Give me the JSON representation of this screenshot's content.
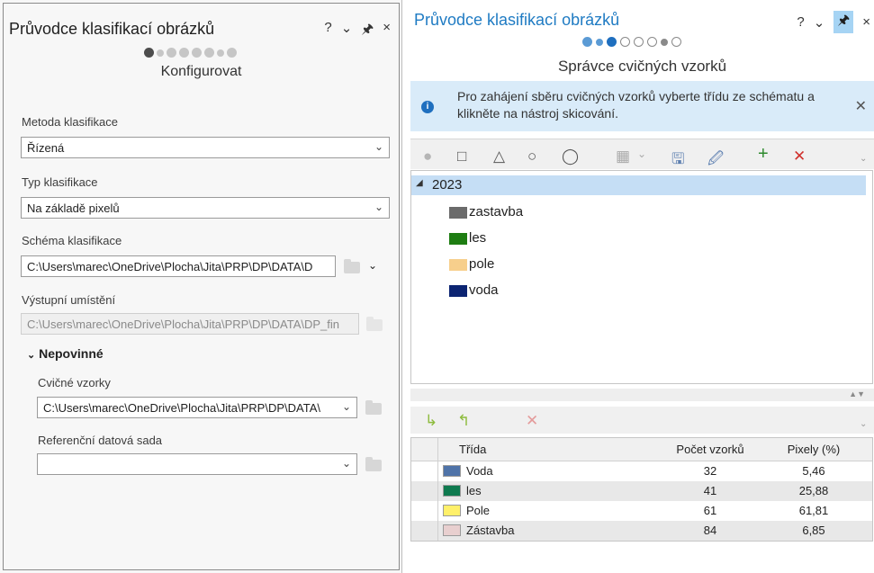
{
  "left_panel": {
    "title": "Průvodce klasifikací obrázků",
    "controls": [
      "?",
      "⌄",
      "⊓",
      "×"
    ],
    "step_title": "Konfigurovat",
    "classification_method": {
      "label": "Metoda klasifikace",
      "value": "Řízená"
    },
    "classification_type": {
      "label": "Typ klasifikace",
      "value": "Na základě pixelů"
    },
    "classification_schema": {
      "label": "Schéma klasifikace",
      "value": "C:\\Users\\marec\\OneDrive\\Plocha\\Jita\\PRP\\DP\\DATA\\D"
    },
    "output_location": {
      "label": "Výstupní umístění",
      "value": "C:\\Users\\marec\\OneDrive\\Plocha\\Jita\\PRP\\DP\\DATA\\DP_fin"
    },
    "optional": {
      "section_label": "Nepovinné",
      "training_samples": {
        "label": "Cvičné vzorky",
        "value": "C:\\Users\\marec\\OneDrive\\Plocha\\Jita\\PRP\\DP\\DATA\\"
      },
      "reference_dataset": {
        "label": "Referenční datová sada",
        "value": ""
      }
    }
  },
  "right_panel": {
    "title": "Průvodce klasifikací obrázků",
    "controls": [
      "?",
      "⌄",
      "⊓",
      "×"
    ],
    "step_title": "Správce cvičných vzorků",
    "info_message": "Pro zahájení sběru cvičných vzorků vyberte třídu ze schématu a klikněte na nástroj skicování.",
    "tree": {
      "root": "2023",
      "items": [
        {
          "label": "zastavba",
          "color": "#6b6b6b"
        },
        {
          "label": "les",
          "color": "#1e7d12"
        },
        {
          "label": "pole",
          "color": "#f7cf8c"
        },
        {
          "label": "voda",
          "color": "#0c2472"
        }
      ]
    },
    "table": {
      "columns": [
        "Třída",
        "Počet vzorků",
        "Pixely (%)"
      ],
      "rows": [
        {
          "name": "Voda",
          "count": "32",
          "pixels": "5,46",
          "color": "#4f73a8"
        },
        {
          "name": "les",
          "count": "41",
          "pixels": "25,88",
          "color": "#0f7a4f"
        },
        {
          "name": "Pole",
          "count": "61",
          "pixels": "61,81",
          "color": "#fff06a"
        },
        {
          "name": "Zástavba",
          "count": "84",
          "pixels": "6,85",
          "color": "#e8cfcf"
        }
      ]
    }
  }
}
